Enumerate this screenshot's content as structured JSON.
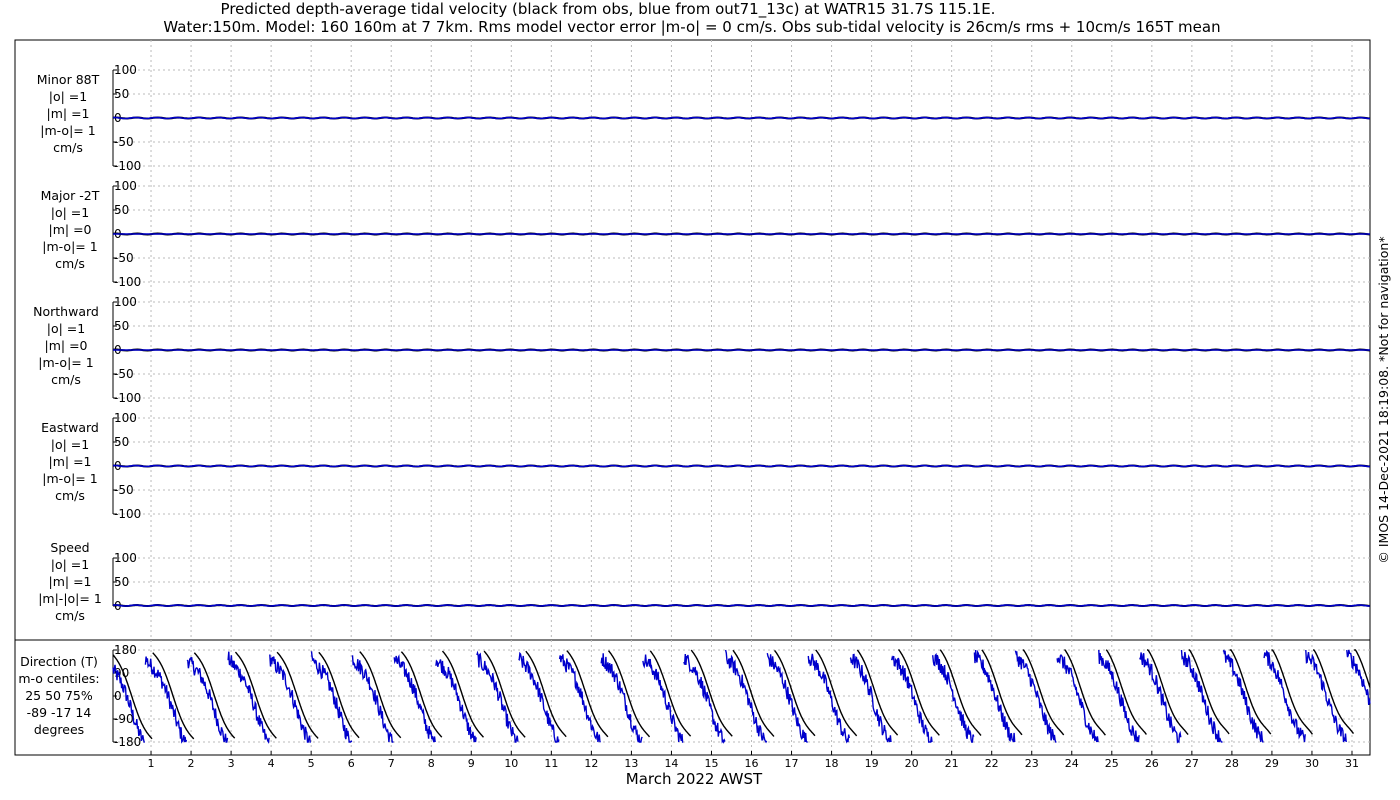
{
  "title_line1": "Predicted depth-average tidal velocity (black from obs, blue from out71_13c) at WATR15 31.7S 115.1E.",
  "title_line2": "Water:150m. Model: 160 160m at 7 7km. Rms model vector error |m-o| = 0 cm/s. Obs sub-tidal velocity is 26cm/s rms + 10cm/s 165T mean",
  "side_note": "© IMOS 14-Dec-2021 18:19:08. *Not for navigation*",
  "colors": {
    "obs": "#000000",
    "model": "#0000cc",
    "grid": "#bbbbbb"
  },
  "chart_data": {
    "type": "line",
    "xlabel": "March 2022 AWST",
    "x_ticks": [
      "1",
      "2",
      "3",
      "4",
      "5",
      "6",
      "7",
      "8",
      "9",
      "10",
      "11",
      "12",
      "13",
      "14",
      "15",
      "16",
      "17",
      "18",
      "19",
      "20",
      "21",
      "22",
      "23",
      "24",
      "25",
      "26",
      "27",
      "28",
      "29",
      "30",
      "31"
    ],
    "xlim": [
      0.05,
      31.45
    ],
    "grid": true,
    "panels": [
      {
        "labels": [
          "Minor 88T",
          "|o| =1",
          "|m| =1",
          "|m-o|= 1",
          "cm/s"
        ],
        "yticks": [
          "100",
          "50",
          "0",
          "-50",
          "-100"
        ],
        "ylim": [
          -100,
          100
        ],
        "series": [
          {
            "role": "obs",
            "amplitude": 1,
            "mean": 0
          },
          {
            "role": "model",
            "amplitude": 1,
            "mean": 0
          }
        ]
      },
      {
        "labels": [
          "Major -2T",
          "|o| =1",
          "|m| =0",
          "|m-o|= 1",
          "cm/s"
        ],
        "yticks": [
          "100",
          "50",
          "0",
          "-50",
          "-100"
        ],
        "ylim": [
          -100,
          100
        ],
        "series": [
          {
            "role": "obs",
            "amplitude": 1,
            "mean": 0
          },
          {
            "role": "model",
            "amplitude": 0,
            "mean": 0
          }
        ]
      },
      {
        "labels": [
          "Northward",
          "|o| =1",
          "|m| =0",
          "|m-o|= 1",
          "cm/s"
        ],
        "yticks": [
          "100",
          "50",
          "0",
          "-50",
          "-100"
        ],
        "ylim": [
          -100,
          100
        ],
        "series": [
          {
            "role": "obs",
            "amplitude": 1,
            "mean": 0
          },
          {
            "role": "model",
            "amplitude": 0,
            "mean": 0
          }
        ]
      },
      {
        "labels": [
          "Eastward",
          "|o| =1",
          "|m| =1",
          "|m-o|= 1",
          "cm/s"
        ],
        "yticks": [
          "100",
          "50",
          "0",
          "-50",
          "-100"
        ],
        "ylim": [
          -100,
          100
        ],
        "series": [
          {
            "role": "obs",
            "amplitude": 1,
            "mean": 0
          },
          {
            "role": "model",
            "amplitude": 1,
            "mean": 0
          }
        ]
      },
      {
        "labels": [
          "Speed",
          "|o| =1",
          "|m| =1",
          "|m|-|o|= 1",
          "cm/s"
        ],
        "yticks": [
          "100",
          "50",
          "0"
        ],
        "ylim": [
          0,
          100
        ],
        "series": [
          {
            "role": "obs",
            "amplitude": 1,
            "mean": 1
          },
          {
            "role": "model",
            "amplitude": 1,
            "mean": 1
          }
        ]
      },
      {
        "labels": [
          "Direction (T)",
          "m-o centiles:",
          "25  50  75%",
          "-89 -17  14",
          "degrees"
        ],
        "yticks": [
          "180",
          "90",
          "0",
          "-90",
          "-180"
        ],
        "ylim": [
          -180,
          180
        ],
        "series": [
          {
            "role": "obs",
            "description": "sawtooth direction wrapping at ±180 with ~1.03 day period"
          },
          {
            "role": "model",
            "description": "sawtooth direction wrapping at ±180, noisier, offset from obs"
          }
        ]
      }
    ]
  }
}
